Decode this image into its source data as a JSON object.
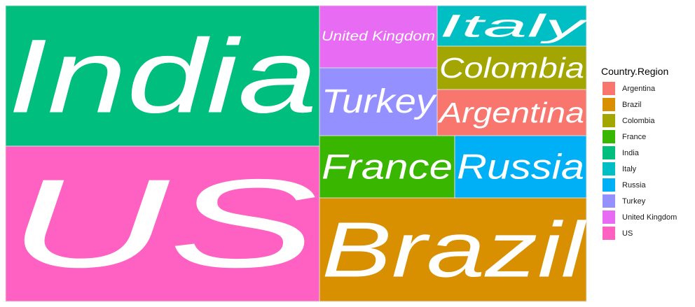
{
  "chart_data": {
    "type": "treemap",
    "legend_title": "Country.Region",
    "legend_position": "right",
    "tiles": [
      {
        "label": "US",
        "color": "#FF61C3"
      },
      {
        "label": "India",
        "color": "#00BE7D"
      },
      {
        "label": "Brazil",
        "color": "#D89000"
      },
      {
        "label": "France",
        "color": "#39B600"
      },
      {
        "label": "Russia",
        "color": "#00B0F6"
      },
      {
        "label": "Turkey",
        "color": "#9590FF"
      },
      {
        "label": "United Kingdom",
        "color": "#E76BF3"
      },
      {
        "label": "Argentina",
        "color": "#F8766D"
      },
      {
        "label": "Colombia",
        "color": "#A3A500"
      },
      {
        "label": "Italy",
        "color": "#00BFC4"
      }
    ],
    "legend": [
      {
        "label": "Argentina",
        "color": "#F8766D"
      },
      {
        "label": "Brazil",
        "color": "#D89000"
      },
      {
        "label": "Colombia",
        "color": "#A3A500"
      },
      {
        "label": "France",
        "color": "#39B600"
      },
      {
        "label": "India",
        "color": "#00BE7D"
      },
      {
        "label": "Italy",
        "color": "#00BFC4"
      },
      {
        "label": "Russia",
        "color": "#00B0F6"
      },
      {
        "label": "Turkey",
        "color": "#9590FF"
      },
      {
        "label": "United Kingdom",
        "color": "#E76BF3"
      },
      {
        "label": "US",
        "color": "#FF61C3"
      }
    ]
  }
}
